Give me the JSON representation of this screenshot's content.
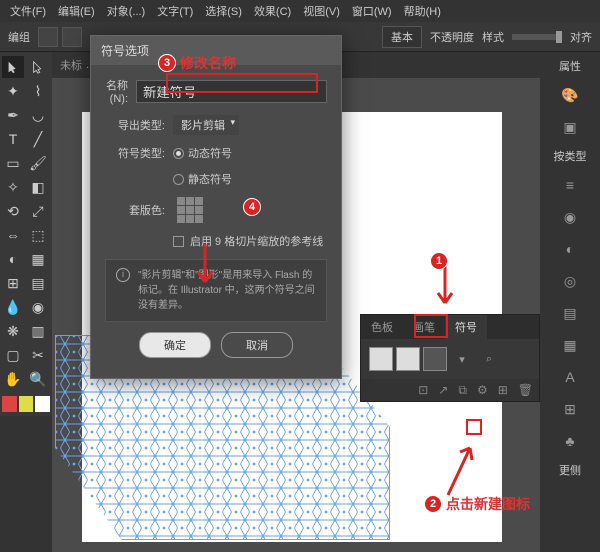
{
  "menu": {
    "file": "文件(F)",
    "edit": "编辑(E)",
    "object": "对象(...)",
    "type": "文字(T)",
    "select": "选择(S)",
    "effect": "效果(C)",
    "view": "视图(V)",
    "window": "窗口(W)",
    "help": "帮助(H)"
  },
  "optbar": {
    "label": "编组",
    "basic": "基本",
    "opacity_label": "不透明度",
    "style_label": "样式",
    "align": "对齐"
  },
  "tab": {
    "prefix": "未标",
    "suffix": "..."
  },
  "dialog": {
    "title": "符号选项",
    "name_label": "名称(N):",
    "name_value": "新建符号",
    "export_label": "导出类型:",
    "export_value": "影片剪辑",
    "symbol_type_label": "符号类型:",
    "radio_dynamic": "动态符号",
    "radio_static": "静态符号",
    "registration_label": "套版色:",
    "nine_slice": "启用 9 格切片缩放的参考线",
    "info_text": "\"影片剪辑\"和\"图形\"是用来导入 Flash 的标记。在 Illustrator 中，这两个符号之间没有差异。",
    "ok": "确定",
    "cancel": "取消"
  },
  "symbols_panel": {
    "tab1": "色板",
    "tab2": "画笔",
    "tab3": "符号"
  },
  "right": {
    "properties": "属性",
    "by_type": "按类型",
    "change": "更侧"
  },
  "annotations": {
    "n1": "1",
    "n2": "2",
    "n3": "3",
    "n4": "4",
    "t3": "修改名称",
    "t2": "点击新建图标"
  }
}
